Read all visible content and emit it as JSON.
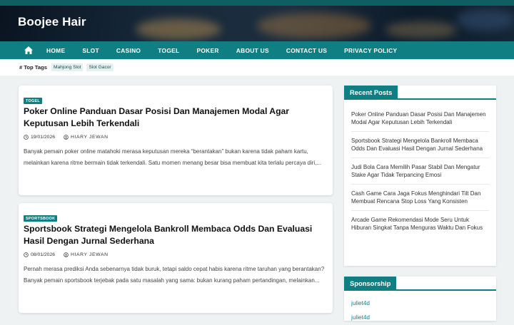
{
  "site": {
    "title": "Boojee Hair"
  },
  "nav": {
    "items": [
      "HOME",
      "SLOT",
      "CASINO",
      "TOGEL",
      "POKER",
      "ABOUT US",
      "CONTACT US",
      "PRIVACY POLICY"
    ]
  },
  "tags": {
    "label": "# Top Tags",
    "items": [
      "Mahjong Slot",
      "Slot Gacor"
    ]
  },
  "posts": [
    {
      "category": "TOGEL",
      "title": "Poker Online Panduan Dasar Posisi Dan Manajemen Modal Agar Keputusan Lebih Terkendali",
      "date": "19/01/2026",
      "author": "HIARY JEWAN",
      "excerpt": "Banyak pemain poker online matahoki merasa keputusan mereka “berantakan” bukan karena tidak paham kartu, melainkan karena ritme bermain tidak terkendali. Satu momen menang besar bisa membuat kita terlalu percaya diri,..."
    },
    {
      "category": "SPORTSBOOK",
      "title": "Sportsbook Strategi Mengelola Bankroll Membaca Odds Dan Evaluasi Hasil Dengan Jurnal Sederhana",
      "date": "08/01/2026",
      "author": "HIARY JEWAN",
      "excerpt": "Pernah merasa prediksi Anda sebenarnya tidak buruk, tetapi saldo cepat habis karena ritme taruhan yang berantakan? Banyak pemain sportsbook terjebak pada satu masalah yang sama: bukan kurang paham pertandingan, melainkan..."
    }
  ],
  "sidebar": {
    "recent_title": "Recent Posts",
    "recent": [
      "Poker Online Panduan Dasar Posisi Dan Manajemen Modal Agar Keputusan Lebih Terkendali",
      "Sportsbook Strategi Mengelola Bankroll Membaca Odds Dan Evaluasi Hasil Dengan Jurnal Sederhana",
      "Judi Bola Cara Memilih Pasar Stabil Dan Mengatur Stake Agar Tidak Terpancing Emosi",
      "Cash Game Cara Jaga Fokus Menghindari Tilt Dan Membuat Rencana Stop Loss Yang Konsisten",
      "Arcade Game Rekomendasi Mode Seru Untuk Hiburan Singkat Tanpa Menguras Waktu Dan Fokus"
    ],
    "sponsor_title": "Sponsorship",
    "sponsors": [
      "juliet4d",
      "juliet4d"
    ]
  },
  "colors": {
    "accent": "#0f7f83",
    "topbar": "#0f5e61"
  }
}
